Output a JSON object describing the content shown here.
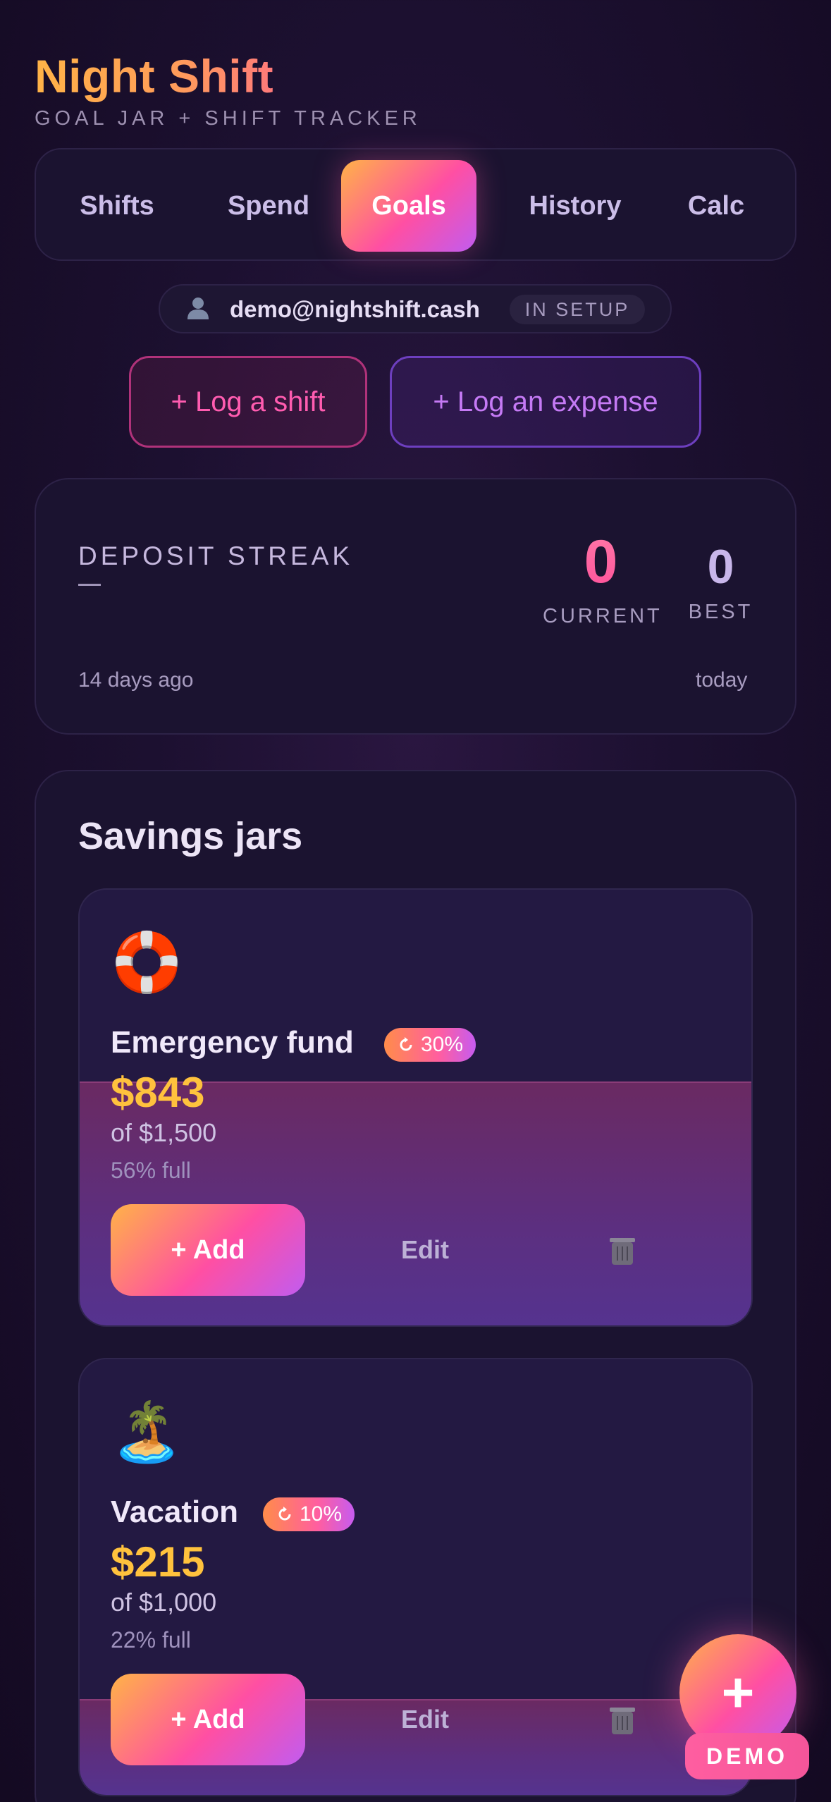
{
  "app": {
    "title": "Night Shift",
    "subtitle": "GOAL JAR + SHIFT TRACKER"
  },
  "tabs": [
    {
      "label": "Shifts",
      "active": false
    },
    {
      "label": "Spend",
      "active": false
    },
    {
      "label": "Goals",
      "active": true
    },
    {
      "label": "History",
      "active": false
    },
    {
      "label": "Calc",
      "active": false
    }
  ],
  "account": {
    "icon": "person-icon",
    "email": "demo@nightshift.cash",
    "status": "IN SETUP"
  },
  "actions": {
    "log_shift": "+ Log a shift",
    "log_expense": "+ Log an expense"
  },
  "streak": {
    "title": "DEPOSIT STREAK",
    "current_value": "0",
    "current_label": "CURRENT",
    "best_value": "0",
    "best_label": "BEST",
    "range_start": "14 days ago",
    "range_end": "today"
  },
  "savings": {
    "title": "Savings jars",
    "jars": [
      {
        "emoji": "🛟",
        "name": "Emergency fund",
        "rate": "30%",
        "amount": "$843",
        "target": "of $1,500",
        "fill_text": "56% full",
        "fill_fraction": 0.56,
        "add_label": "+ Add",
        "edit_label": "Edit",
        "delete_icon": "trash-icon"
      },
      {
        "emoji": "🏝️",
        "name": "Vacation",
        "rate": "10%",
        "amount": "$215",
        "target": "of $1,000",
        "fill_text": "22% full",
        "fill_fraction": 0.22,
        "add_label": "+ Add",
        "edit_label": "Edit",
        "delete_icon": "trash-icon"
      }
    ]
  },
  "fab": {
    "label": "+"
  },
  "demo_badge": "DEMO",
  "colors": {
    "accent_orange": "#ffb347",
    "accent_pink": "#ff4fa3",
    "accent_purple": "#c15cf0",
    "amount_gold": "#ffc23d",
    "background": "#1c1030"
  }
}
